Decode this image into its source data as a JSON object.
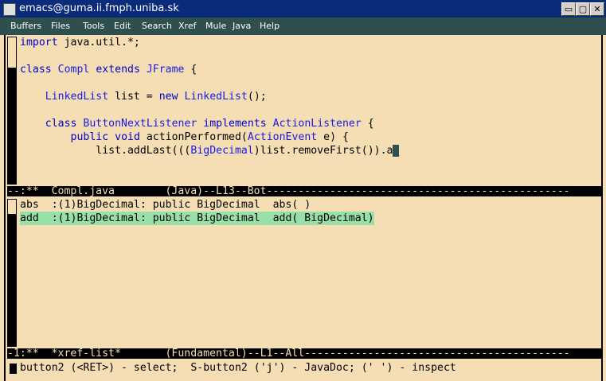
{
  "window": {
    "title": "emacs@guma.ii.fmph.uniba.sk",
    "minimize_glyph": "▭",
    "restore_glyph": "▢",
    "close_glyph": "✕"
  },
  "menu": [
    "Buffers",
    "Files",
    "Tools",
    "Edit",
    "Search",
    "Xref",
    "Mule",
    "Java",
    "Help"
  ],
  "editor": {
    "lines": [
      [
        "import java.util.*;"
      ],
      [
        ""
      ],
      [
        "class Compl extends JFrame {"
      ],
      [
        ""
      ],
      [
        "    LinkedList list = new LinkedList();"
      ],
      [
        ""
      ],
      [
        "    class ButtonNextListener implements ActionListener {"
      ],
      [
        "        public void actionPerformed(ActionEvent e) {"
      ],
      [
        "            list.addLast(((BigDecimal)list.removeFirst()).a"
      ]
    ],
    "modeline": "--:**  Compl.java        (Java)--L13--Bot------------------------------------------------"
  },
  "xref": {
    "rows": [
      "abs  :(1)BigDecimal: public BigDecimal  abs( )",
      "add  :(1)BigDecimal: public BigDecimal  add( BigDecimal)"
    ],
    "modeline": "-1:**  *xref-list*       (Fundamental)--L1--All------------------------------------------"
  },
  "minibuffer": "button2 (<RET>) - select;  S-button2 ('j') - JavaDoc; (' ') - inspect",
  "colors": {
    "background": "#f5deb3",
    "keyword": "#0000cd",
    "highlight": "#98e0a8",
    "menubar": "#2f4f4f",
    "titlebar": "#0a2a7a"
  }
}
